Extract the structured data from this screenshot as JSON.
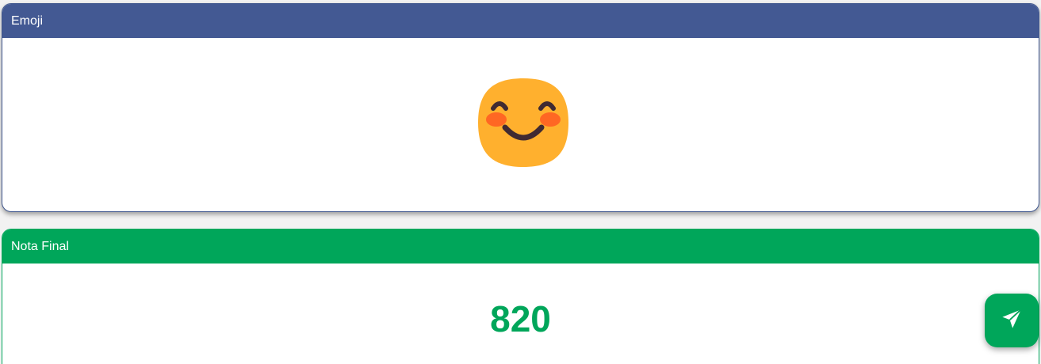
{
  "emoji_card": {
    "title": "Emoji",
    "emoji_icon": "smiling-face-with-smiling-eyes-icon"
  },
  "nota_card": {
    "title": "Nota Final",
    "score": "820"
  },
  "send_button": {
    "icon": "paper-plane-icon"
  },
  "colors": {
    "emoji_header": "#435993",
    "nota_header": "#00a65a",
    "score_text": "#00a65a",
    "emoji_face": "#ffb02e"
  }
}
